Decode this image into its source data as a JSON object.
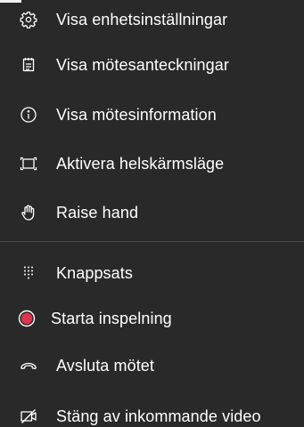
{
  "menu": {
    "items": [
      {
        "label": "Visa enhetsinställningar",
        "icon": "gear-icon"
      },
      {
        "label": "Visa mötesanteckningar",
        "icon": "notes-icon"
      },
      {
        "label": "Visa mötesinformation",
        "icon": "info-icon"
      },
      {
        "label": "Aktivera helskärmsläge",
        "icon": "fullscreen-icon"
      },
      {
        "label": "Raise hand",
        "icon": "hand-icon"
      },
      {
        "label": "Knappsats",
        "icon": "dialpad-icon"
      },
      {
        "label": "Starta inspelning",
        "icon": "record-icon"
      },
      {
        "label": "Avsluta mötet",
        "icon": "hang-up-icon"
      },
      {
        "label": "Stäng av inkommande video",
        "icon": "video-off-icon"
      }
    ]
  },
  "colors": {
    "background": "#292929",
    "text": "#ffffff",
    "divider": "#474747",
    "record": "#e0334d"
  }
}
